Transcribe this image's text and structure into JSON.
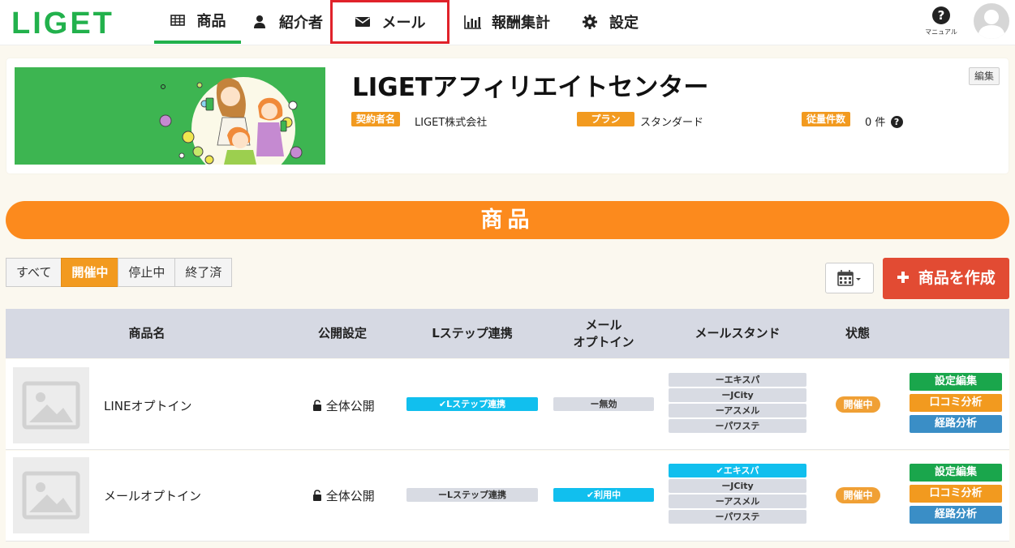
{
  "logo": "LIGET",
  "nav": {
    "items": [
      {
        "label": "商品",
        "icon": "grid-icon"
      },
      {
        "label": "紹介者",
        "icon": "user-icon"
      },
      {
        "label": "メール",
        "icon": "envelope-icon"
      },
      {
        "label": "報酬集計",
        "icon": "bar-chart-icon"
      },
      {
        "label": "設定",
        "icon": "gear-icon"
      }
    ],
    "help_label": "マニュアル",
    "help_symbol": "?"
  },
  "header": {
    "title": "LIGETアフィリエイトセンター",
    "edit_label": "編集",
    "contract_label": "契約者名",
    "contract_value": "LIGET株式会社",
    "plan_label": "プラン",
    "plan_value": "スタンダード",
    "usage_label": "従量件数",
    "usage_value": "0 件",
    "usage_help": "?"
  },
  "section_title": "商品",
  "filters": [
    "すべて",
    "開催中",
    "停止中",
    "終了済"
  ],
  "create_button": "商品を作成",
  "table": {
    "columns": [
      "商品名",
      "公開設定",
      "Lステップ連携",
      "メール\nオプトイン",
      "メールスタンド",
      "状態"
    ],
    "rows": [
      {
        "name": "LINEオプトイン",
        "publicity": "全体公開",
        "lstep": "✔Lステップ連携",
        "optin": "ー無効",
        "stands": [
          "ーエキスパ",
          "ーJCity",
          "ーアスメル",
          "ーパワステ"
        ],
        "status": "開催中",
        "actions": [
          "設定編集",
          "口コミ分析",
          "経路分析"
        ]
      },
      {
        "name": "メールオプトイン",
        "publicity": "全体公開",
        "lstep": "ーLステップ連携",
        "optin": "✔利用中",
        "stands": [
          "✔エキスパ",
          "ーJCity",
          "ーアスメル",
          "ーパワステ"
        ],
        "status": "開催中",
        "actions": [
          "設定編集",
          "口コミ分析",
          "経路分析"
        ]
      }
    ]
  },
  "colors": {
    "brand_green": "#22b14c",
    "accent_orange": "#fc8a1d",
    "tag_orange": "#f29a1f",
    "create_red": "#e24b33",
    "cyan": "#11bfee",
    "highlight_red": "#e0222a"
  }
}
